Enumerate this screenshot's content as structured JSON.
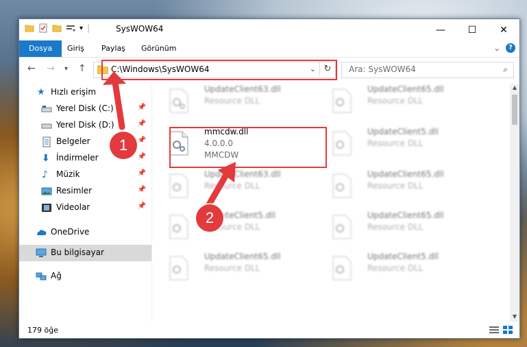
{
  "window": {
    "title": "SysWOW64"
  },
  "ribbon": {
    "tabs": [
      "Dosya",
      "Giriş",
      "Paylaş",
      "Görünüm"
    ]
  },
  "address": {
    "path": "C:\\Windows\\SysWOW64"
  },
  "search": {
    "placeholder": "Ara: SysWOW64"
  },
  "sidebar": {
    "items": [
      {
        "label": "Hızlı erişim",
        "icon": "star-icon"
      },
      {
        "label": "Yerel Disk (C:)",
        "icon": "drive-icon",
        "pinned": true
      },
      {
        "label": "Yerel Disk (D:)",
        "icon": "drive-icon",
        "pinned": true
      },
      {
        "label": "Belgeler",
        "icon": "documents-icon",
        "pinned": true
      },
      {
        "label": "İndirmeler",
        "icon": "download-icon",
        "pinned": true
      },
      {
        "label": "Müzik",
        "icon": "music-icon",
        "pinned": true
      },
      {
        "label": "Resimler",
        "icon": "pictures-icon",
        "pinned": true
      },
      {
        "label": "Videolar",
        "icon": "videos-icon",
        "pinned": true
      },
      {
        "label": "OneDrive",
        "icon": "cloud-icon"
      },
      {
        "label": "Bu bilgisayar",
        "icon": "computer-icon",
        "selected": true
      },
      {
        "label": "Ağ",
        "icon": "network-icon"
      }
    ]
  },
  "files": [
    {
      "name": "UpdateClient63.dll",
      "desc": "Resource DLL"
    },
    {
      "name": "UpdateClient65.dll",
      "desc": "Resource DLL"
    },
    {
      "name": "mmcdw.dll",
      "version": "4.0.0.0",
      "company": "MMCDW"
    },
    {
      "name": "UpdateClient5.dll",
      "desc": "Resource DLL"
    },
    {
      "name": "UpdateClient63.dll",
      "desc": "Resource DLL"
    },
    {
      "name": "UpdateClient65.dll",
      "desc": "Resource DLL"
    },
    {
      "name": "UpdateClient5.dll",
      "desc": "Resource DLL"
    },
    {
      "name": "UpdateClient65.dll",
      "desc": "Resource DLL"
    },
    {
      "name": "UpdateClient65.dll",
      "desc": "Resource DLL"
    },
    {
      "name": "UpdateClient5.dll",
      "desc": "Resource DLL"
    }
  ],
  "status": {
    "count": "179 öğe"
  },
  "annotations": {
    "badge1": "1",
    "badge2": "2"
  },
  "colors": {
    "accent": "#1979ca",
    "highlight": "#e5383b"
  }
}
